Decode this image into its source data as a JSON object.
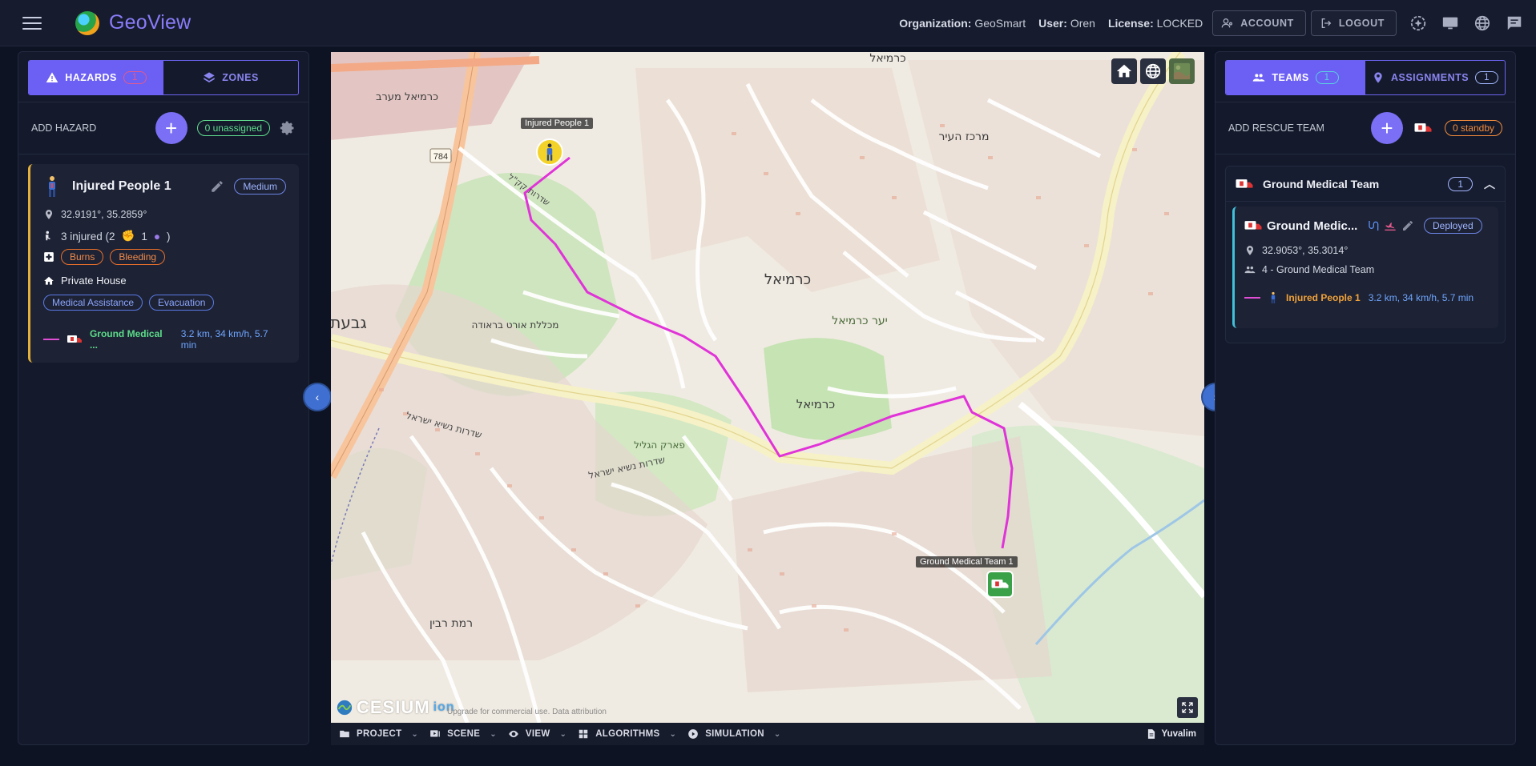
{
  "app": {
    "title": "GeoView"
  },
  "header": {
    "organization_label": "Organization:",
    "organization": "GeoSmart",
    "user_label": "User:",
    "user": "Oren",
    "license_label": "License:",
    "license": "LOCKED",
    "account_label": "ACCOUNT",
    "logout_label": "LOGOUT"
  },
  "left_panel": {
    "tabs": [
      {
        "label": "HAZARDS",
        "count": "1"
      },
      {
        "label": "ZONES"
      }
    ],
    "add_label": "ADD HAZARD",
    "unassigned": "0 unassigned",
    "hazard": {
      "name": "Injured People 1",
      "severity": "Medium",
      "coords": "32.9191°, 35.2859°",
      "injured": "3 injured (2",
      "injured_b": "1",
      "injured_c": ")",
      "conditions": [
        "Burns",
        "Bleeding"
      ],
      "location": "Private House",
      "needs": [
        "Medical Assistance",
        "Evacuation"
      ],
      "assignment": {
        "team": "Ground Medical ...",
        "route": "3.2 km, 34 km/h, 5.7 min"
      }
    }
  },
  "right_panel": {
    "tabs": [
      {
        "label": "TEAMS",
        "count": "1"
      },
      {
        "label": "ASSIGNMENTS",
        "count": "1"
      }
    ],
    "add_label": "ADD RESCUE TEAM",
    "standby": "0 standby",
    "group": {
      "name": "Ground Medical Team",
      "count": "1"
    },
    "team": {
      "name": "Ground Medic...",
      "status": "Deployed",
      "coords": "32.9053°, 35.3014°",
      "members": "4 - Ground Medical Team",
      "target": "Injured People 1",
      "route": "3.2 km, 34 km/h, 5.7 min"
    }
  },
  "map": {
    "labels": {
      "hazard": "Injured People 1",
      "team": "Ground Medical Team 1",
      "city": "כרמיאל",
      "road_784": "784",
      "street_a": "שדרות נשיא ישראל",
      "street_b": "שדרות קק\"ל",
      "area_a": "פארק הגליל",
      "area_b": "רמת רבין",
      "area_c": "מכללת אורט בראודה",
      "area_d": "יער כרמיאל",
      "area_e": "גבעת",
      "area_f": "מרכז העיר",
      "area_g": "כרמיאל מערב"
    },
    "cesium": "CESIUM",
    "cesium_ion": "ion",
    "attribution": "Upgrade for commercial use.   Data attribution",
    "route_color": "#e033d8"
  },
  "toolbar": {
    "items": [
      "PROJECT",
      "SCENE",
      "VIEW",
      "ALGORITHMS",
      "SIMULATION"
    ],
    "location": "Yuvalim"
  }
}
